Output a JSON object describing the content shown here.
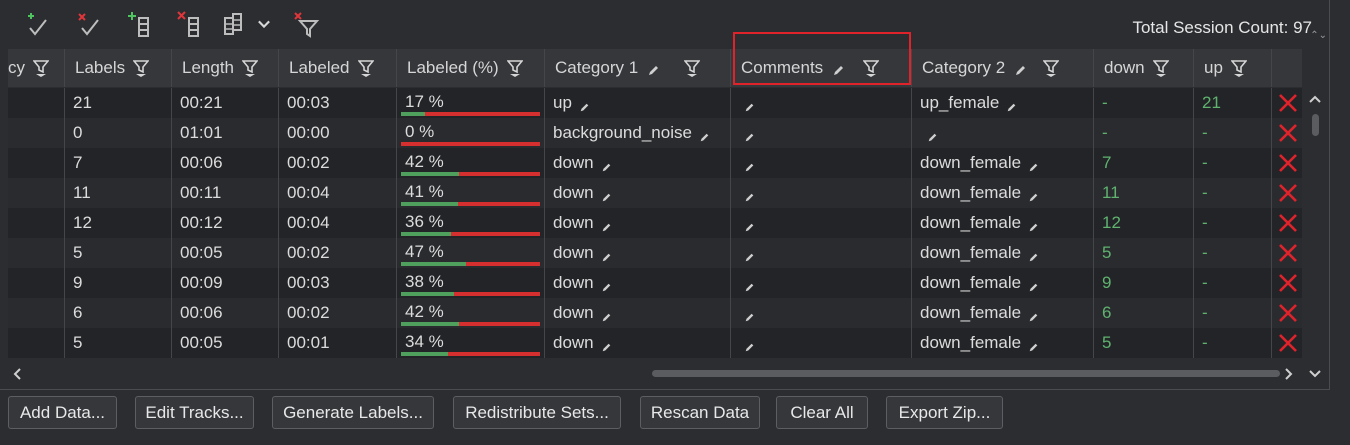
{
  "toolbar": {
    "buttons": [
      {
        "name": "accept-all-icon"
      },
      {
        "name": "reject-all-icon"
      },
      {
        "name": "add-column-icon"
      },
      {
        "name": "remove-column-icon"
      },
      {
        "name": "column-layout-icon"
      },
      {
        "name": "chevron-down-icon"
      },
      {
        "name": "clear-filter-icon"
      }
    ],
    "session_count": "Total Session Count: 97"
  },
  "columns": {
    "partial": "cy",
    "labels": "Labels",
    "length": "Length",
    "labeled": "Labeled",
    "labeled_pct": "Labeled (%)",
    "category1": "Category 1",
    "comments": "Comments",
    "category2": "Category 2",
    "down": "down",
    "up": "up"
  },
  "rows": [
    {
      "labels": "21",
      "length": "00:21",
      "labeled": "00:03",
      "pct_text": "17 %",
      "pct": 17,
      "cat1": "up",
      "cat2": "up_female",
      "down": "-",
      "up": "21"
    },
    {
      "labels": "0",
      "length": "01:01",
      "labeled": "00:00",
      "pct_text": "0 %",
      "pct": 0,
      "cat1": "background_noise",
      "cat2": "",
      "down": "-",
      "up": "-"
    },
    {
      "labels": "7",
      "length": "00:06",
      "labeled": "00:02",
      "pct_text": "42 %",
      "pct": 42,
      "cat1": "down",
      "cat2": "down_female",
      "down": "7",
      "up": "-"
    },
    {
      "labels": "11",
      "length": "00:11",
      "labeled": "00:04",
      "pct_text": "41 %",
      "pct": 41,
      "cat1": "down",
      "cat2": "down_female",
      "down": "11",
      "up": "-"
    },
    {
      "labels": "12",
      "length": "00:12",
      "labeled": "00:04",
      "pct_text": "36 %",
      "pct": 36,
      "cat1": "down",
      "cat2": "down_female",
      "down": "12",
      "up": "-"
    },
    {
      "labels": "5",
      "length": "00:05",
      "labeled": "00:02",
      "pct_text": "47 %",
      "pct": 47,
      "cat1": "down",
      "cat2": "down_female",
      "down": "5",
      "up": "-"
    },
    {
      "labels": "9",
      "length": "00:09",
      "labeled": "00:03",
      "pct_text": "38 %",
      "pct": 38,
      "cat1": "down",
      "cat2": "down_female",
      "down": "9",
      "up": "-"
    },
    {
      "labels": "6",
      "length": "00:06",
      "labeled": "00:02",
      "pct_text": "42 %",
      "pct": 42,
      "cat1": "down",
      "cat2": "down_female",
      "down": "6",
      "up": "-"
    },
    {
      "labels": "5",
      "length": "00:05",
      "labeled": "00:01",
      "pct_text": "34 %",
      "pct": 34,
      "cat1": "down",
      "cat2": "down_female",
      "down": "5",
      "up": "-"
    }
  ],
  "actions": {
    "add_data": "Add Data...",
    "edit_tracks": "Edit Tracks...",
    "generate_labels": "Generate Labels...",
    "redistribute_sets": "Redistribute Sets...",
    "rescan_data": "Rescan Data",
    "clear_all": "Clear All",
    "export_zip": "Export Zip..."
  },
  "colors": {
    "progress_fill": "#4fa05c",
    "progress_track": "#d62f2f",
    "delete": "#e0232b",
    "highlight": "#e0232b",
    "count_value": "#5fb36f"
  }
}
